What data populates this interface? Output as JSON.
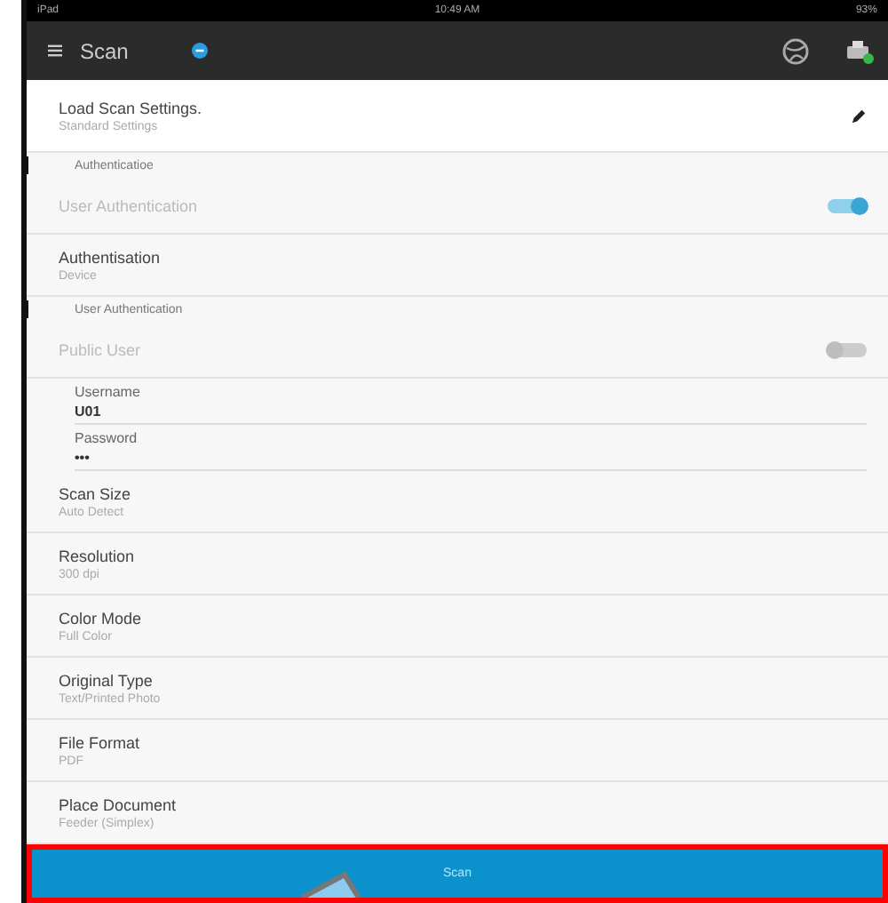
{
  "status_bar": {
    "carrier": "iPad",
    "time": "10:49 AM",
    "battery": "93%"
  },
  "toolbar": {
    "title": "Scan"
  },
  "items": [
    {
      "kind": "setting",
      "title": "Load Scan Settings.",
      "value": "Standard Settings",
      "editable": true
    },
    {
      "kind": "section",
      "title": "Authenticatioe"
    },
    {
      "kind": "toggle",
      "title": "User Authentication",
      "on": true
    },
    {
      "kind": "setting",
      "title": "Authentisation",
      "value": "Device",
      "editable": false
    },
    {
      "kind": "section",
      "title": "User Authentication"
    },
    {
      "kind": "toggle",
      "title": "Public User",
      "on": false
    },
    {
      "kind": "field",
      "title": "Username",
      "value": "U01"
    },
    {
      "kind": "field",
      "title": "Password",
      "value": "•••"
    },
    {
      "kind": "setting",
      "title": "Scan Size",
      "value": "Auto Detect",
      "editable": false
    },
    {
      "kind": "setting",
      "title": "Resolution",
      "value": "300 dpi",
      "editable": false
    },
    {
      "kind": "setting",
      "title": "Color Mode",
      "value": "Full Color",
      "editable": false
    },
    {
      "kind": "setting",
      "title": "Original Type",
      "value": "Text/Printed Photo",
      "editable": false
    },
    {
      "kind": "setting",
      "title": "File Format",
      "value": "PDF",
      "editable": false
    },
    {
      "kind": "setting",
      "title": "Place Document",
      "value": "Feeder (Simplex)",
      "editable": false
    }
  ],
  "scan_button": {
    "label": "Scan",
    "highlighted": true
  }
}
